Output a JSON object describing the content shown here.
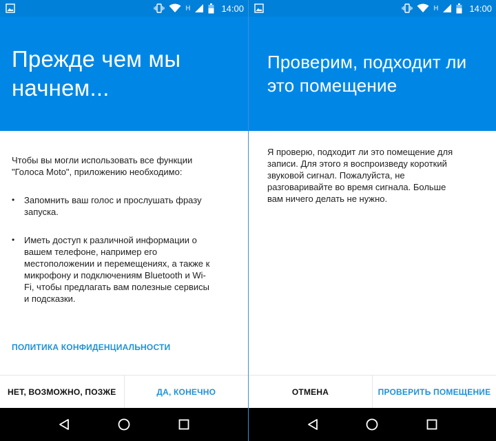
{
  "status_bar": {
    "time": "14:00",
    "network_label": "H",
    "icons": [
      "image-icon",
      "vibrate-icon",
      "wifi-icon",
      "signal-icon",
      "battery-icon"
    ]
  },
  "colors": {
    "header_blue": "#0087e6",
    "status_blue": "#0080d8",
    "accent_link": "#1e92d8"
  },
  "screen1": {
    "title": "Прежде чем мы начнем...",
    "intro": "Чтобы вы могли использовать все функции \"Голоса Moto\", приложению необходимо:",
    "bullets": [
      "Запомнить ваш голос и прослушать фразу запуска.",
      "Иметь доступ к различной информации о вашем телефоне, например его местоположении и перемещениях, а также к микрофону и подключениям Bluetooth и Wi-Fi, чтобы предлагать вам полезные сервисы и подсказки."
    ],
    "privacy_link": "ПОЛИТИКА КОНФИДЕНЦИАЛЬНОСТИ",
    "button_negative": "НЕТ, ВОЗМОЖНО, ПОЗЖЕ",
    "button_positive": "ДА, КОНЕЧНО"
  },
  "screen2": {
    "title": "Проверим, подходит ли это помещение",
    "body": "Я проверю, подходит ли это помещение для записи. Для этого я воспроизведу короткий звуковой сигнал. Пожалуйста, не разговаривайте во время сигнала. Больше вам ничего делать не нужно.",
    "button_negative": "ОТМЕНА",
    "button_positive": "ПРОВЕРИТЬ ПОМЕЩЕНИЕ"
  },
  "nav_bar": {
    "icons": [
      "back-icon",
      "home-icon",
      "recents-icon"
    ]
  }
}
